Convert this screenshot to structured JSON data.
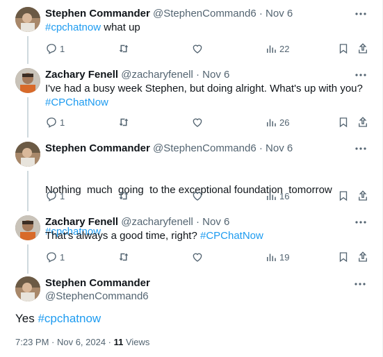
{
  "tweets": [
    {
      "name": "Stephen Commander",
      "handle": "@StephenCommand6",
      "sep": "·",
      "date": "Nov 6",
      "hashtag": "#cpchatnow",
      "text_after": " what up",
      "replies": "1",
      "views": "22"
    },
    {
      "name": "Zachary Fenell",
      "handle": "@zacharyfenell",
      "sep": "·",
      "date": "Nov 6",
      "text_line1": "I've had a busy week Stephen, but doing alright. What's up with you?",
      "hashtag": "#CPChatNow",
      "replies": "1",
      "views": "26"
    },
    {
      "name": "Stephen Commander",
      "handle": "@StephenCommand6",
      "sep": "·",
      "date": "Nov 6",
      "text_line1": "Nothing  much  going  to the exceptional foundation  tomorrow",
      "hashtag": "#cpchatnow",
      "replies": "1",
      "views": "16"
    },
    {
      "name": "Zachary Fenell",
      "handle": "@zacharyfenell",
      "sep": "·",
      "date": "Nov 6",
      "text_before": "That's always a good time, right? ",
      "hashtag": "#CPChatNow",
      "replies": "1",
      "views": "19"
    }
  ],
  "main_tweet": {
    "name": "Stephen Commander",
    "handle": "@StephenCommand6",
    "text_before": "Yes ",
    "hashtag": "#cpchatnow",
    "time": "7:23 PM · Nov 6, 2024 · ",
    "views_count": "11",
    "views_label": " Views"
  },
  "icons": {
    "reply": "reply-icon",
    "retweet": "retweet-icon",
    "like": "heart-icon",
    "views": "analytics-icon",
    "bookmark": "bookmark-icon",
    "share": "share-icon",
    "more": "more-icon"
  },
  "colors": {
    "link": "#1d9bf0",
    "secondary": "#536471",
    "thread_line": "#cfd9de"
  }
}
